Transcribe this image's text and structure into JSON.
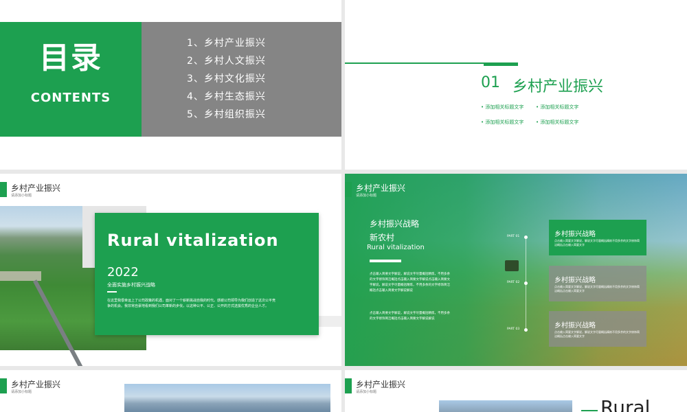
{
  "slide1": {
    "title": "目录",
    "subtitle": "CONTENTS",
    "items": [
      "1、乡村产业振兴",
      "2、乡村人文振兴",
      "3、乡村文化振兴",
      "4、乡村生态振兴",
      "5、乡村组织振兴"
    ]
  },
  "slide2": {
    "number": "01",
    "title": "乡村产业振兴",
    "bullets": [
      "添加相关标题文字",
      "添加相关标题文字",
      "添加相关标题文字",
      "添加相关标题文字"
    ]
  },
  "slide3": {
    "header_title": "乡村产业振兴",
    "header_sub": "请添加小标题",
    "heading": "Rural vitalization",
    "year": "2022",
    "slogan": "全面实施乡村振兴战略",
    "body": "在这里我很幸运上了公司政策的机遇，面对了一个崭新挑战自我的时代。感谢公司领导为我们创造了这次公平竞争的机会。我非常自豪地看到我们公司革新的步伐，以这种公平、公正、公开的方式选拔优秀的企业人才。"
  },
  "slide4": {
    "header_title": "乡村产业振兴",
    "header_sub": "请添加小标题",
    "line1": "乡村振兴战略",
    "line2": "新农村",
    "line3": "Rural vitalization",
    "para1": "点击输入简要文字解说，解说文字尽量概括精炼，不用多余的文字修饰简洁概括点击输入简要文字解说点击输入简要文字解说，解说文字尽量概括精炼，不用多余的文字修饰简洁概括点击输入简要文字解说解说",
    "para2": "点击输入简要文字解说，解说文字尽量概括精炼，不用多余的文字修饰简洁概括点击输入简要文字解说解说",
    "parts": [
      "PART 01",
      "PART 02",
      "PART 03"
    ],
    "boxes": [
      {
        "title": "乡村振兴战略",
        "body": "点击输入简要文字解说，解说文字尽量概括精炼不用多余的文字修饰简洁概括点击输入简要文字"
      },
      {
        "title": "乡村振兴战略",
        "body": "点击输入简要文字解说，解说文字尽量概括精炼不用多余的文字修饰简洁概括点击输入简要文字"
      },
      {
        "title": "乡村振兴战略",
        "body": "点击输入简要文字解说，解说文字尽量概括精炼不用多余的文字修饰简洁概括点击输入简要文字"
      }
    ],
    "colors": {
      "box1": "#1da050",
      "box2": "rgba(140,140,140,0.75)",
      "box3": "rgba(140,140,140,0.75)"
    }
  },
  "slide5": {
    "header_title": "乡村产业振兴",
    "header_sub": "请添加小标题"
  },
  "slide6": {
    "header_title": "乡村产业振兴",
    "header_sub": "请添加小标题",
    "heading": "Rural"
  },
  "colors": {
    "brand_green": "#1da050",
    "toc_gray": "#858585"
  }
}
